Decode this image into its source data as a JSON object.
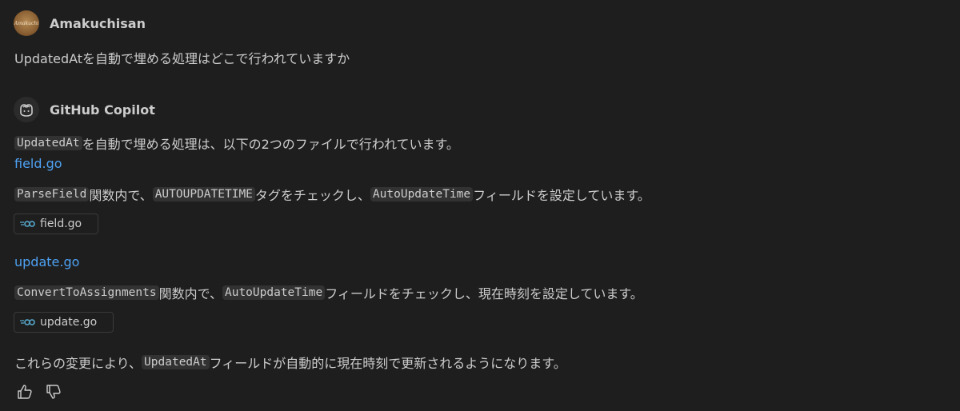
{
  "user": {
    "name": "Amakuchisan",
    "avatar_text": "Amakuchi",
    "message": "UpdatedAtを自動で埋める処理はどこで行われていますか"
  },
  "assistant": {
    "name": "GitHub Copilot",
    "intro": {
      "code": "UpdatedAt",
      "text": "を自動で埋める処理は、以下の2つのファイルで行われています。"
    },
    "sections": [
      {
        "link": "field.go",
        "code1": "ParseField",
        "text1": "関数内で、",
        "code2": "AUTOUPDATETIME",
        "text2": "タグをチェックし、",
        "code3": "AutoUpdateTime",
        "text3": "フィールドを設定しています。",
        "chip": "field.go"
      },
      {
        "link": "update.go",
        "code1": "ConvertToAssignments",
        "text1": "関数内で、",
        "code2": "AutoUpdateTime",
        "text2": "フィールドをチェックし、現在時刻を設定しています。",
        "chip": "update.go"
      }
    ],
    "conclusion": {
      "text1": "これらの変更により、",
      "code": "UpdatedAt",
      "text2": "フィールドが自動的に現在時刻で更新されるようになります。"
    }
  },
  "icons": {
    "copilot": "copilot-icon",
    "go_file": "go-file-icon",
    "thumbs_up": "thumbs-up-icon",
    "thumbs_down": "thumbs-down-icon"
  },
  "colors": {
    "background": "#1e1e1e",
    "text": "#cccccc",
    "link": "#4ea1f3",
    "code_bg": "#323232",
    "go_icon": "#519aba"
  }
}
